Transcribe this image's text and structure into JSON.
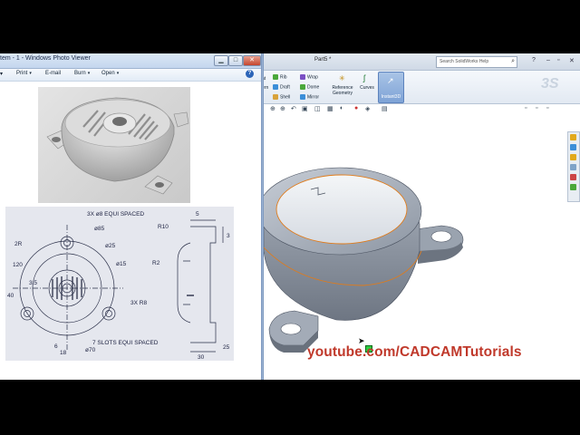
{
  "photo_viewer": {
    "title": "tem - 1 - Windows Photo Viewer",
    "menu": {
      "print": "Print",
      "email": "E-mail",
      "burn": "Burn",
      "open": "Open",
      "help": "?"
    },
    "window_buttons": {
      "minimize": "▁",
      "maximize": "□",
      "close": "✕"
    },
    "drawing": {
      "dims": [
        "3X ø8 EQUI SPACED",
        "ø85",
        "ø25",
        "ø15",
        "3X R8",
        "7 SLOTS EQUI SPACED",
        "ø70",
        "2R",
        "120",
        "40",
        "3.5",
        "6",
        "18",
        "R10",
        "R2",
        "5",
        "3",
        "25",
        "30"
      ]
    }
  },
  "solidworks": {
    "doc_title": "Part5 *",
    "search_placeholder": "Search SolidWorks Help",
    "ribbon": {
      "col1": [
        "Rib",
        "Draft",
        "Shell"
      ],
      "col2": [
        "Wrap",
        "Dome",
        "Mirror"
      ],
      "reference_geometry": "Reference Geometry",
      "curves": "Curves",
      "instant3d": "Instant3D",
      "left_partial": [
        "at",
        "ern"
      ]
    }
  },
  "watermark": "youtube.com/CADCAMTutorials",
  "colors": {
    "sw_model": "#8e98a6",
    "edge_highlight": "#e07b1a",
    "watermark": "#c0392b",
    "selection_handle": "#2ecc40"
  }
}
